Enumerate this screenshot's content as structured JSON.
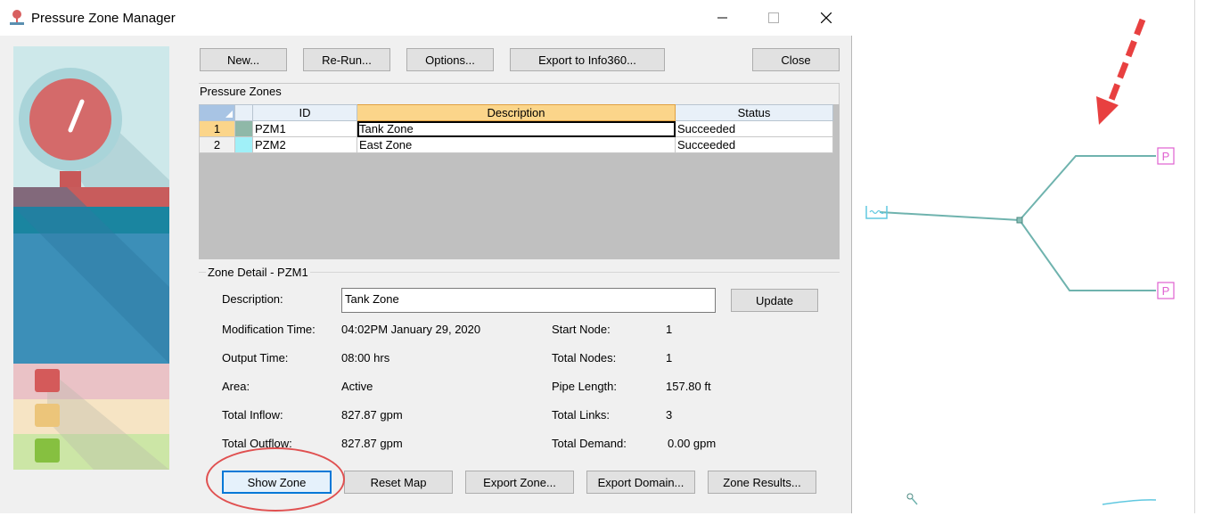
{
  "window": {
    "title": "Pressure Zone Manager",
    "icons": {
      "app": "app-icon",
      "minimize": "minimize-icon",
      "maximize": "maximize-icon",
      "close": "close-icon"
    }
  },
  "toolbar": {
    "new_label": "New...",
    "rerun_label": "Re-Run...",
    "options_label": "Options...",
    "export_info360_label": "Export to Info360...",
    "close_label": "Close"
  },
  "zones": {
    "section_label": "Pressure Zones",
    "columns": {
      "id": "ID",
      "description": "Description",
      "status": "Status"
    },
    "rows": [
      {
        "num": "1",
        "color": "#8fb8a8",
        "id": "PZM1",
        "description": "Tank Zone",
        "status": "Succeeded"
      },
      {
        "num": "2",
        "color": "#a0f0f8",
        "id": "PZM2",
        "description": "East Zone",
        "status": "Succeeded"
      }
    ]
  },
  "detail": {
    "group_title": "Zone Detail - PZM1",
    "description_label": "Description:",
    "description_value": "Tank Zone",
    "update_label": "Update",
    "fields_left": [
      {
        "label": "Modification Time:",
        "value": "04:02PM January 29, 2020"
      },
      {
        "label": "Output Time:",
        "value": "08:00 hrs"
      },
      {
        "label": "Area:",
        "value": "Active"
      },
      {
        "label": "Total Inflow:",
        "value": "827.87 gpm"
      },
      {
        "label": "Total Outflow:",
        "value": "827.87 gpm"
      }
    ],
    "fields_right": [
      {
        "label": "Start Node:",
        "value": "1"
      },
      {
        "label": "Total Nodes:",
        "value": "1"
      },
      {
        "label": "Pipe Length:",
        "value": "157.80 ft"
      },
      {
        "label": "Total Links:",
        "value": "3"
      },
      {
        "label": "Total Demand:",
        "value": "0.00 gpm"
      }
    ]
  },
  "actions": {
    "show_zone_label": "Show Zone",
    "reset_map_label": "Reset Map",
    "export_zone_label": "Export Zone...",
    "export_domain_label": "Export Domain...",
    "zone_results_label": "Zone Results..."
  },
  "map": {
    "pump_label": "P",
    "colors": {
      "pipe": "#6fb3ae",
      "pump": "#e060d0",
      "tank": "#60c8e0",
      "arrow": "#e84040"
    }
  },
  "colors": {
    "accent": "#0078d7",
    "selection": "#fbd58a",
    "annotation": "#e05050"
  }
}
